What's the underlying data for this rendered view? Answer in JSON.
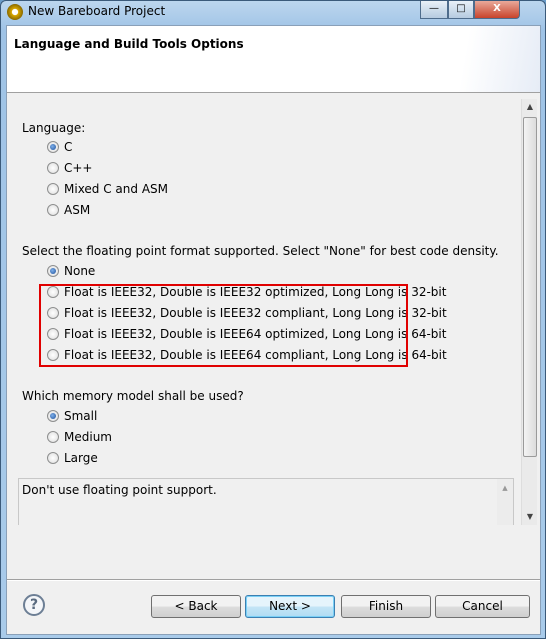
{
  "window": {
    "title": "New Bareboard Project",
    "minimize": "—",
    "maximize": "□",
    "close": "X"
  },
  "header": {
    "title": "Language and Build Tools Options"
  },
  "language": {
    "label": "Language:",
    "options": [
      "C",
      "C++",
      "Mixed C and ASM",
      "ASM"
    ],
    "selected": "C"
  },
  "float": {
    "label": "Select the floating point format supported. Select \"None\" for best code density.",
    "options": [
      "None",
      "Float is IEEE32, Double is IEEE32 optimized, Long Long is 32-bit",
      "Float is IEEE32, Double is IEEE32 compliant, Long Long is 32-bit",
      "Float is IEEE32, Double is IEEE64 optimized, Long Long is 64-bit",
      "Float is IEEE32, Double is IEEE64 compliant, Long Long is 64-bit"
    ],
    "selected": "None",
    "highlight_color": "#e00000"
  },
  "memory": {
    "label": "Which memory model shall be used?",
    "options": [
      "Small",
      "Medium",
      "Large"
    ],
    "selected": "Small"
  },
  "description": "Don't use floating point support.",
  "buttons": {
    "help": "?",
    "back": "< Back",
    "next": "Next >",
    "finish": "Finish",
    "cancel": "Cancel"
  }
}
